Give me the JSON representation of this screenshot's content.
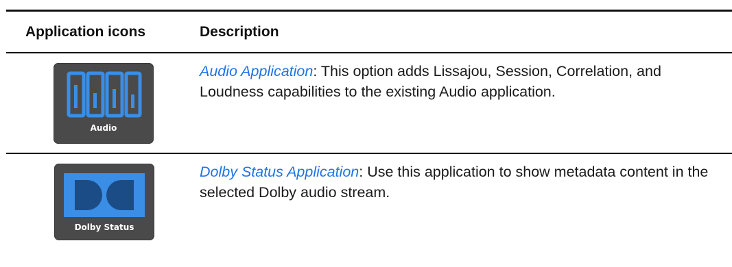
{
  "table": {
    "headers": {
      "icons": "Application icons",
      "description": "Description"
    },
    "rows": [
      {
        "icon_name": "audio-app-icon",
        "icon_label": "Audio",
        "link_text": "Audio Application",
        "description": ": This option adds Lissajou, Session, Correlation, and Loudness capabilities to the existing Audio application."
      },
      {
        "icon_name": "dolby-status-app-icon",
        "icon_label": "Dolby Status",
        "link_text": "Dolby Status Application",
        "description": ": Use this application to show metadata content in the selected Dolby audio stream."
      }
    ]
  },
  "colors": {
    "link": "#1e73e6",
    "tile_background": "#4a4a4a",
    "icon_blue": "#3a8ee6",
    "rule": "#111111"
  }
}
